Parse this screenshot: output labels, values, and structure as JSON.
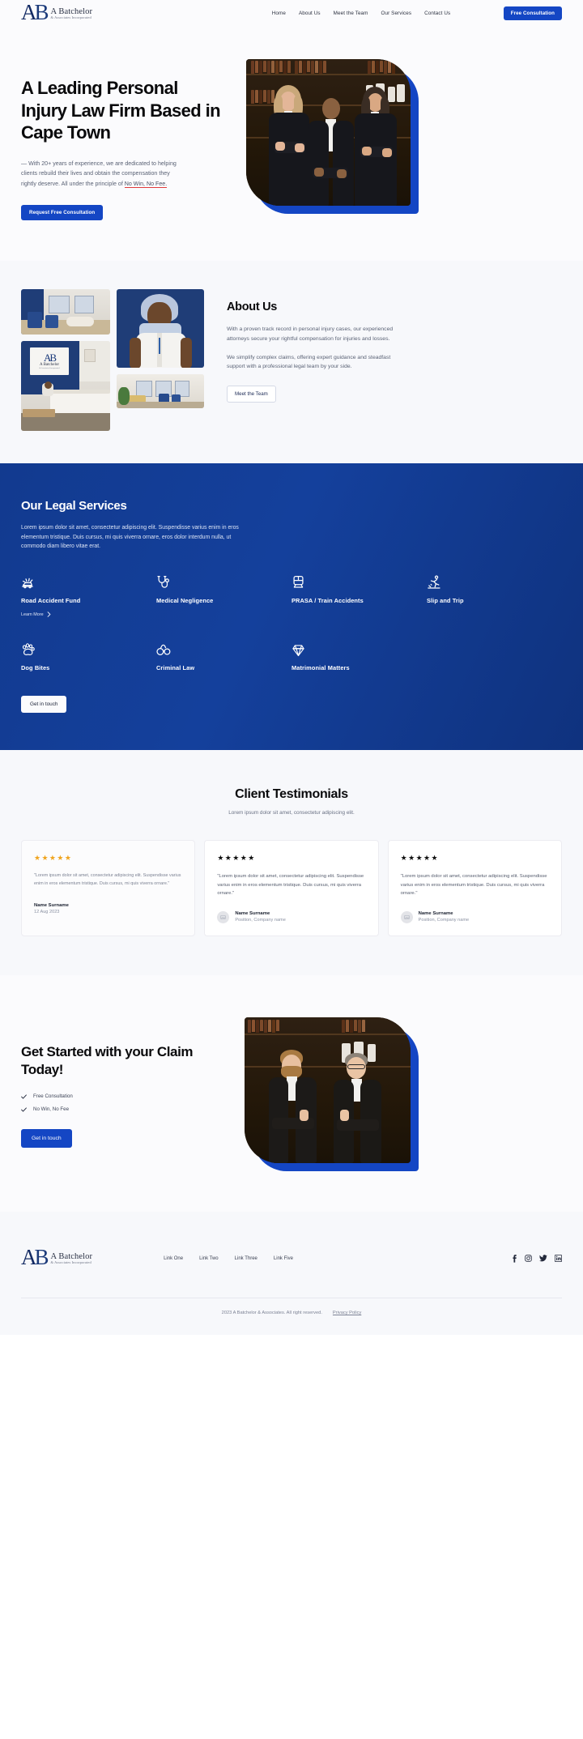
{
  "brand": {
    "mark": "AB",
    "name": "A Batchelor",
    "sub": "& Associates Incorporated"
  },
  "nav": {
    "links": [
      {
        "label": "Home"
      },
      {
        "label": "About Us"
      },
      {
        "label": "Meet the Team"
      },
      {
        "label": "Our Services"
      },
      {
        "label": "Contact Us"
      }
    ],
    "cta": "Free Consultation"
  },
  "hero": {
    "heading": "A Leading Personal Injury Law Firm Based in Cape Town",
    "paragraph_prefix": "— With 20+ years of experience, we are dedicated to helping clients rebuild their lives and obtain the compensation they rightly deserve. All under the principle of ",
    "paragraph_highlight": "No Win, No Fee.",
    "button": "Request Free Consultation"
  },
  "about": {
    "heading": "About Us",
    "paragraph1": "With a proven track record in personal injury cases, our experienced attorneys secure your rightful compensation for injuries and losses.",
    "paragraph2": "We simplify complex claims, offering expert guidance and steadfast support with a professional legal team by your side.",
    "button": "Meet the Team"
  },
  "services": {
    "heading": "Our Legal Services",
    "paragraph": "Lorem ipsum dolor sit amet, consectetur adipiscing elit. Suspendisse varius enim in eros elementum tristique. Duis cursus, mi quis viverra ornare, eros dolor interdum nulla, ut commodo diam libero vitae erat.",
    "items": [
      {
        "label": "Road Accident Fund",
        "icon": "car-crash-icon",
        "more": "Learn More"
      },
      {
        "label": "Medical Negligence",
        "icon": "stethoscope-icon",
        "more": ""
      },
      {
        "label": "PRASA / Train Accidents",
        "icon": "train-icon",
        "more": ""
      },
      {
        "label": "Slip and Trip",
        "icon": "slip-fall-icon",
        "more": ""
      },
      {
        "label": "Dog Bites",
        "icon": "paw-print-icon",
        "more": ""
      },
      {
        "label": "Criminal Law",
        "icon": "handcuffs-icon",
        "more": ""
      },
      {
        "label": "Matrimonial Matters",
        "icon": "diamond-icon",
        "more": ""
      }
    ],
    "button": "Get in touch"
  },
  "testimonials": {
    "heading": "Client Testimonials",
    "subheading": "Lorem ipsum dolor sit amet, consectetur adipiscing elit.",
    "cards": [
      {
        "stars": "★★★★★",
        "quote": "\"Lorem ipsum dolor sit amet, consectetur adipiscing elit. Suspendisse varius enim in eros elementum tristique. Duis cursus, mi quis viverra ornare.\"",
        "name": "Name Surname",
        "meta": "12 Aug 2023"
      },
      {
        "stars": "★★★★★",
        "quote": "\"Lorem ipsum dolor sit amet, consectetur adipiscing elit. Suspendisse varius enim in eros elementum tristique. Duis cursus, mi quis viverra ornare.\"",
        "name": "Name Surname",
        "meta": "Position, Company name"
      },
      {
        "stars": "★★★★★",
        "quote": "\"Lorem ipsum dolor sit amet, consectetur adipiscing elit. Suspendisse varius enim in eros elementum tristique. Duis cursus, mi quis viverra ornare.\"",
        "name": "Name Surname",
        "meta": "Position, Company name"
      }
    ]
  },
  "cta": {
    "heading": "Get Started with your Claim Today!",
    "bullets": [
      {
        "label": "Free Consultation"
      },
      {
        "label": "No Win, No Fee"
      }
    ],
    "button": "Get in touch"
  },
  "footer": {
    "links": [
      {
        "label": "Link One"
      },
      {
        "label": "Link Two"
      },
      {
        "label": "Link Three"
      },
      {
        "label": "Link Five"
      }
    ],
    "socials": [
      {
        "name": "facebook-icon"
      },
      {
        "name": "instagram-icon"
      },
      {
        "name": "twitter-icon"
      },
      {
        "name": "linkedin-icon"
      }
    ],
    "copyright": "2023 A Batchelor & Associates. All right reserved.",
    "privacy": "Privacy Policy"
  },
  "colors": {
    "brand_blue": "#1446c4",
    "deep_navy": "#132a63",
    "services_bg": "#14409c",
    "star_gold": "#f0a41e",
    "underline_red": "#e03b3b"
  }
}
